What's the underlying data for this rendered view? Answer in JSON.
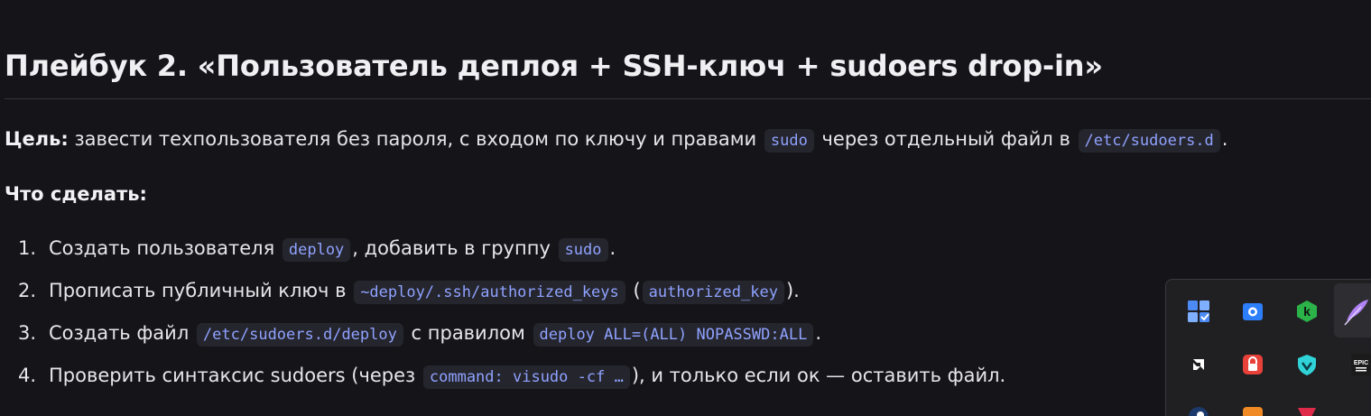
{
  "heading": "Плейбук 2. «Пользователь деплоя + SSH-ключ + sudoers drop-in»",
  "goal": {
    "label": "Цель:",
    "text1": " завести техпользователя без пароля, с входом по ключу и правами ",
    "code1": "sudo",
    "text2": " через отдельный файл в ",
    "code2": "/etc/sudoers.d",
    "text3": "."
  },
  "todo_label": "Что сделать:",
  "steps": [
    {
      "num": "1.",
      "t1": "Создать пользователя ",
      "c1": "deploy",
      "t2": ", добавить в группу ",
      "c2": "sudo",
      "t3": "."
    },
    {
      "num": "2.",
      "t1": "Прописать публичный ключ в ",
      "c1": "~deploy/.ssh/authorized_keys",
      "t2": " (",
      "c2": "authorized_key",
      "t3": ")."
    },
    {
      "num": "3.",
      "t1": "Создать файл ",
      "c1": "/etc/sudoers.d/deploy",
      "t2": " с правилом ",
      "c2": "deploy ALL=(ALL) NOPASSWD:ALL",
      "t3": "."
    },
    {
      "num": "4.",
      "t1": "Проверить синтаксис sudoers (через ",
      "c1": "command: visudo -cf …",
      "t2": "), и только если ок — оставить файл.",
      "c2": "",
      "t3": ""
    }
  ],
  "tray": {
    "icons": [
      {
        "name": "task-manager-icon",
        "color": "#4c8bf5"
      },
      {
        "name": "camera-app-icon",
        "color": "#2d7ff9"
      },
      {
        "name": "k-app-icon",
        "color": "#2bb34a"
      },
      {
        "name": "feather-app-icon",
        "color": "#b183f5"
      },
      {
        "name": "amd-icon",
        "color": "#ffffff"
      },
      {
        "name": "lock-app-icon",
        "color": "#e8413a"
      },
      {
        "name": "shield-vpn-icon",
        "color": "#2fd3d8"
      },
      {
        "name": "epic-games-icon",
        "color": "#ffffff"
      }
    ],
    "epic_text": "EPIC"
  }
}
